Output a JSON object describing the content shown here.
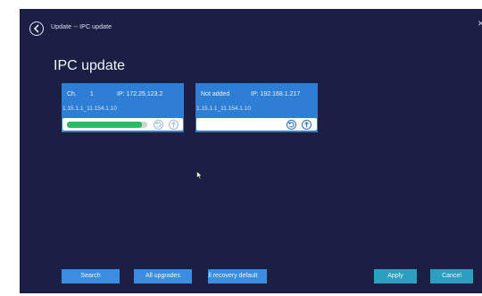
{
  "header": {
    "breadcrumb": "Update -- IPC update",
    "close_glyph": "×"
  },
  "page": {
    "title": "IPC update"
  },
  "cards": [
    {
      "ch_label": "Ch.",
      "ch_number": "1",
      "ip": "IP: 172.25.123.2",
      "version": "1.15.1.1_11.154.1.10",
      "progress": 0.93
    },
    {
      "status": "Not added",
      "ip": "IP: 192.168.1.217",
      "version": "1.15.1.1_11.154.1.10"
    }
  ],
  "buttons": {
    "search": "Search",
    "all_upgrades": "All upgrades",
    "recovery": "All recovery default",
    "apply": "Apply",
    "cancel": "Cancel"
  },
  "colors": {
    "background": "#1b1f44",
    "card": "#2e7ed6",
    "button": "#3a8de0",
    "confirm_button": "#2a9fbf",
    "progress_fill": "#2fb865"
  },
  "icons": {
    "back": "back-arrow-circle-icon",
    "restore": "restore-icon",
    "upload": "upload-icon",
    "close": "close-icon",
    "cursor": "mouse-pointer-icon"
  }
}
